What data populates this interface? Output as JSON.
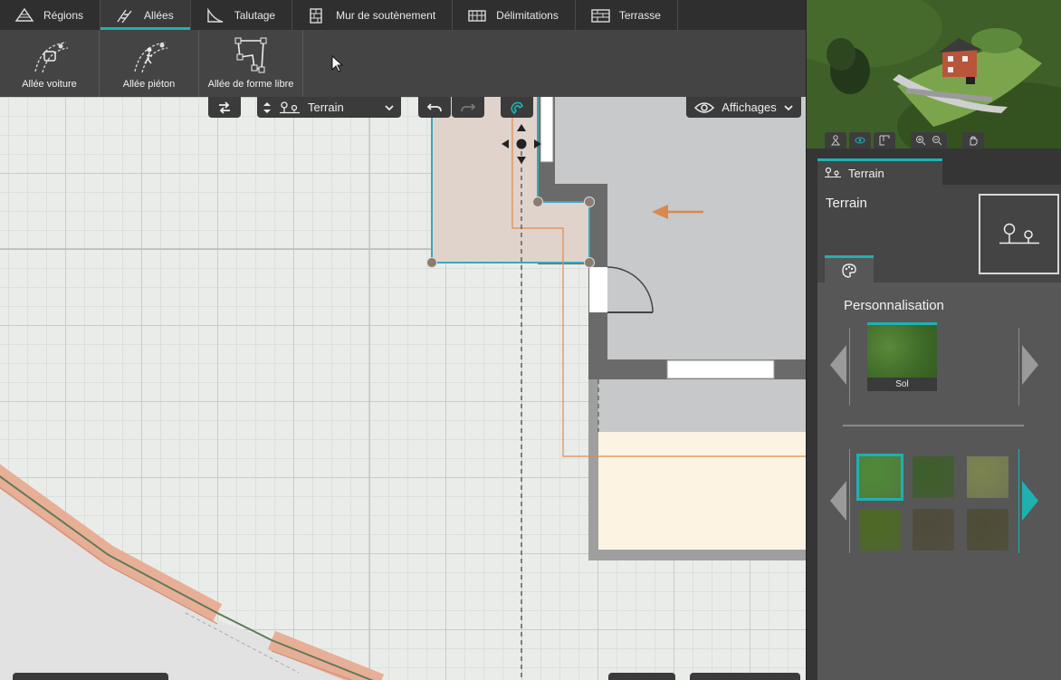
{
  "top_menu": {
    "tabs": [
      {
        "label": "Régions",
        "icon": "regions-icon",
        "active": false
      },
      {
        "label": "Allées",
        "icon": "allees-icon",
        "active": true
      },
      {
        "label": "Talutage",
        "icon": "talutage-icon",
        "active": false
      },
      {
        "label": "Mur de soutènement",
        "icon": "wall-icon",
        "active": false
      },
      {
        "label": "Délimitations",
        "icon": "fence-icon",
        "active": false
      },
      {
        "label": "Terrasse",
        "icon": "terrace-icon",
        "active": false
      }
    ]
  },
  "sub_toolbar": {
    "tools": [
      {
        "label": "Allée voiture",
        "icon": "car-path-icon"
      },
      {
        "label": "Allée piéton",
        "icon": "pedestrian-path-icon"
      },
      {
        "label": "Allée de forme libre",
        "icon": "freeform-path-icon"
      }
    ]
  },
  "canvas_controls": {
    "layer_label": "Terrain",
    "views_label": "Affichages"
  },
  "right_panel": {
    "object_tab_label": "Terrain",
    "object_title": "Terrain",
    "customization_title": "Personnalisation",
    "selected_material_label": "Sol"
  },
  "colors": {
    "accent": "#1fb1b1",
    "selection_fill": "#e0d3cb",
    "wall": "#666666",
    "room_floor": "#c6c8c9",
    "terrace": "#fdf3e2",
    "path": "#e8a98e",
    "annotation_line": "#e08a50"
  },
  "materials": [
    {
      "name": "grass-1",
      "color": "#4f8a36",
      "selected": true
    },
    {
      "name": "grass-2",
      "color": "#3d5e2a",
      "selected": false
    },
    {
      "name": "grass-3",
      "color": "#7c8450",
      "selected": false
    },
    {
      "name": "grass-4",
      "color": "#4d6a24",
      "selected": false
    },
    {
      "name": "soil-1",
      "color": "#4f4a3a",
      "selected": false
    },
    {
      "name": "soil-2",
      "color": "#4e4c34",
      "selected": false
    }
  ]
}
